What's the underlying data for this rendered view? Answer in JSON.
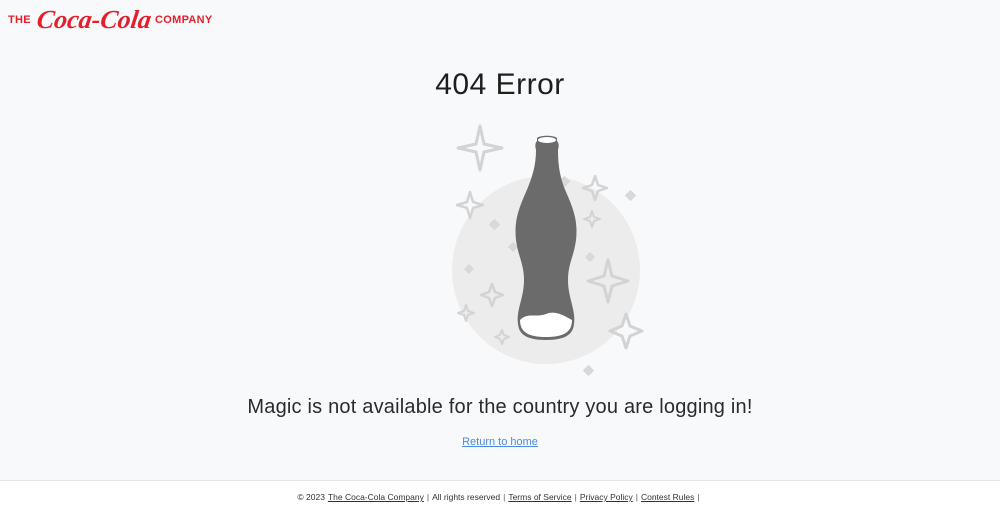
{
  "header": {
    "logo_prefix": "THE",
    "logo_script": "Coca-Cola",
    "logo_suffix": "COMPANY"
  },
  "main": {
    "title": "404 Error",
    "illustration_icon": "coca-cola-bottle-icon",
    "message": "Magic is not available for the country you are logging in!",
    "return_link": "Return to home"
  },
  "footer": {
    "copyright_prefix": "© 2023",
    "company_link": "The Coca-Cola Company",
    "rights_text": "All rights reserved",
    "links": [
      "Terms of Service",
      "Privacy Policy",
      "Contest Rules"
    ]
  },
  "colors": {
    "brand_red": "#e41e2b",
    "link_blue": "#4a8ce0",
    "bottle_gray": "#6b6b6b",
    "background": "#f8f9fb"
  }
}
